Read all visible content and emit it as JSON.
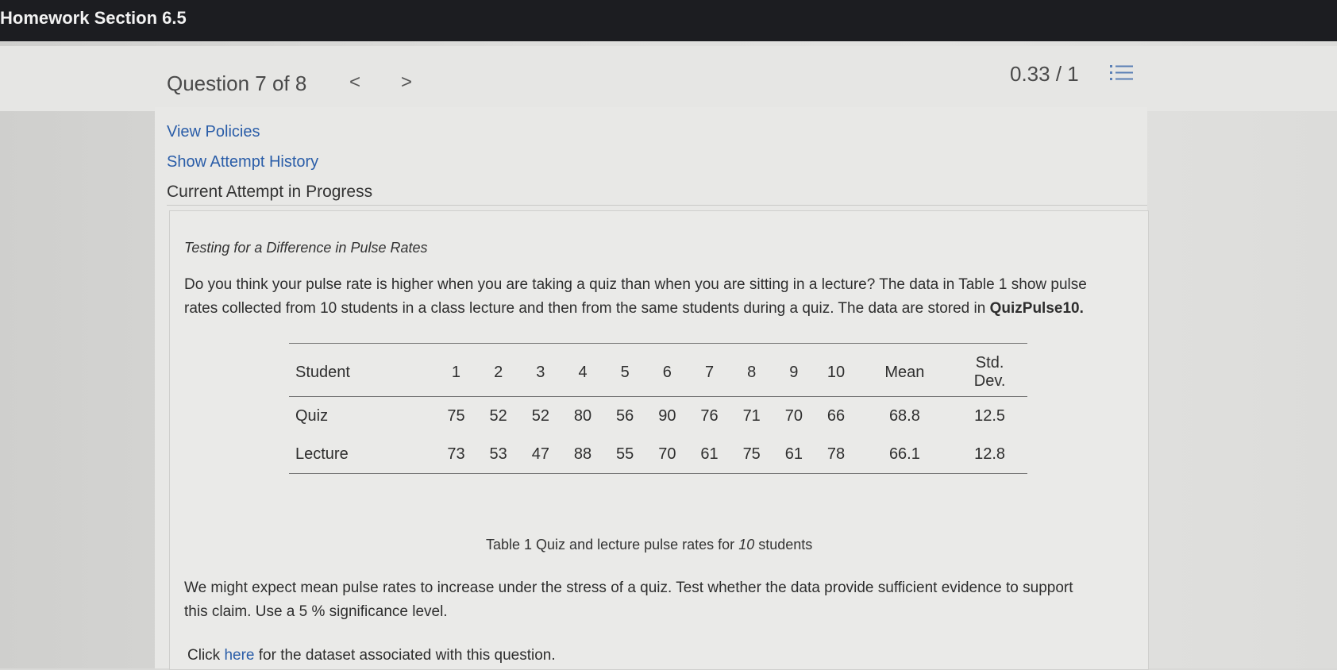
{
  "header": {
    "section_title": "Homework Section 6.5"
  },
  "question_bar": {
    "question_label": "Question 7 of 8",
    "prev_symbol": "<",
    "next_symbol": ">",
    "score": "0.33 / 1",
    "list_icon": "numbered-list-icon"
  },
  "links": {
    "view_policies": "View Policies",
    "show_attempt_history": "Show Attempt History"
  },
  "attempt_status": "Current Attempt in Progress",
  "problem": {
    "title": "Testing for a Difference in Pulse Rates",
    "intro_line1": "Do you think your pulse rate is higher when you are taking a quiz than when you are sitting in a lecture? The data in Table 1 show pulse",
    "intro_line2_prefix": "rates collected from 10 students in a class lecture and then from the same students during a quiz. The data are stored in ",
    "dataset_name": "QuizPulse10.",
    "table": {
      "headers": [
        "Student",
        "1",
        "2",
        "3",
        "4",
        "5",
        "6",
        "7",
        "8",
        "9",
        "10",
        "Mean",
        "Std.",
        "Dev."
      ],
      "rows": [
        {
          "label": "Quiz",
          "values": [
            "75",
            "52",
            "52",
            "80",
            "56",
            "90",
            "76",
            "71",
            "70",
            "66"
          ],
          "mean": "68.8",
          "sd": "12.5"
        },
        {
          "label": "Lecture",
          "values": [
            "73",
            "53",
            "47",
            "88",
            "55",
            "70",
            "61",
            "75",
            "61",
            "78"
          ],
          "mean": "66.1",
          "sd": "12.8"
        }
      ]
    },
    "caption_prefix": "Table 1 Quiz and lecture pulse rates for ",
    "caption_number": "10",
    "caption_suffix": " students",
    "claim_line1": "We might expect mean pulse rates to increase under the stress of a quiz. Test whether the data provide sufficient evidence to support",
    "claim_line2": "this claim. Use a 5 % significance level.",
    "footer_prefix": "Click ",
    "footer_link": "here",
    "footer_suffix": " for the dataset associated with this question."
  }
}
